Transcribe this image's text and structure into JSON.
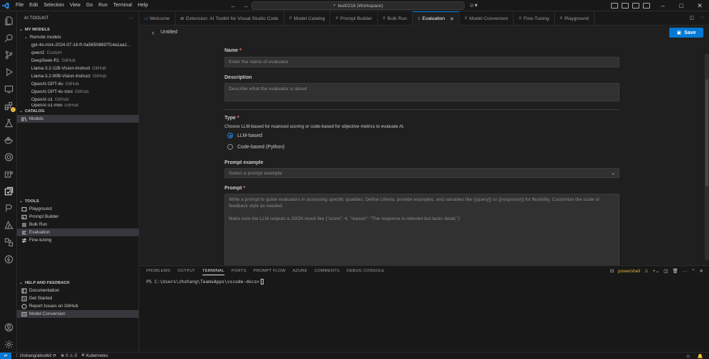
{
  "menu": [
    "File",
    "Edit",
    "Selection",
    "View",
    "Go",
    "Run",
    "Terminal",
    "Help"
  ],
  "command_center": {
    "label": "test0218 (Workspace)"
  },
  "colors": {
    "accent": "#0078d4",
    "required": "#f48771",
    "warning": "#e3b341"
  },
  "sidebar": {
    "title": "AI TOOLKIT",
    "my_models": {
      "title": "MY MODELS",
      "group": "Remote models",
      "items": [
        {
          "label": "gpt-4o-mini-2024-07-18-ft-0a56508897f14a1aa1...",
          "source": ""
        },
        {
          "label": "qwen2",
          "source": "Custom"
        },
        {
          "label": "DeepSeek-R1",
          "source": "GitHub"
        },
        {
          "label": "Llama-3.2-11B-Vision-Instruct",
          "source": "GitHub"
        },
        {
          "label": "Llama-3.2-90B-Vision-Instruct",
          "source": "GitHub"
        },
        {
          "label": "OpenAI GPT-4o",
          "source": "GitHub"
        },
        {
          "label": "OpenAI GPT-4o mini",
          "source": "GitHub"
        },
        {
          "label": "OpenAI o1",
          "source": "GitHub"
        },
        {
          "label": "OpenAI o1-mini",
          "source": "GitHub"
        }
      ]
    },
    "catalog": {
      "title": "CATALOG",
      "items": [
        {
          "label": "Models",
          "icon": "models-icon"
        }
      ]
    },
    "tools": {
      "title": "TOOLS",
      "items": [
        {
          "label": "Playground",
          "icon": "playground-icon"
        },
        {
          "label": "Prompt Builder",
          "icon": "prompt-builder-icon"
        },
        {
          "label": "Bulk Run",
          "icon": "bulk-run-icon"
        },
        {
          "label": "Evaluation",
          "icon": "evaluation-icon"
        },
        {
          "label": "Fine-tuning",
          "icon": "fine-tuning-icon"
        }
      ]
    },
    "help": {
      "title": "HELP AND FEEDBACK",
      "items": [
        {
          "label": "Documentation",
          "icon": "book-icon"
        },
        {
          "label": "Get Started",
          "icon": "rocket-icon"
        },
        {
          "label": "Report Issues on GitHub",
          "icon": "github-icon"
        },
        {
          "label": "Model Conversion",
          "icon": "conversion-icon"
        }
      ]
    }
  },
  "tabs": [
    {
      "label": "Welcome",
      "icon": "vscode-icon"
    },
    {
      "label": "Extension: AI Toolkit for Visual Studio Code",
      "icon": "extension-icon"
    },
    {
      "label": "Model Catalog",
      "icon": "aitk-icon"
    },
    {
      "label": "Prompt Builder",
      "icon": "aitk-icon"
    },
    {
      "label": "Bulk Run",
      "icon": "aitk-icon"
    },
    {
      "label": "Evaluation",
      "icon": "aitk-icon",
      "active": true
    },
    {
      "label": "Model Conversion",
      "icon": "aitk-icon"
    },
    {
      "label": "Fine-Tuning",
      "icon": "aitk-icon"
    },
    {
      "label": "Playground",
      "icon": "aitk-icon"
    }
  ],
  "editor": {
    "title": "Untitled",
    "save_label": "Save",
    "form": {
      "name_label": "Name",
      "name_placeholder": "Enter the name of evaluator",
      "description_label": "Description",
      "description_placeholder": "Describe what the evaluator is about",
      "type_label": "Type",
      "type_helper": "Choose LLM-based for nuanced scoring or code-based for objective metrics to evaluate AI.",
      "type_options": [
        {
          "label": "LLM-based",
          "selected": true
        },
        {
          "label": "Code-based (Python)",
          "selected": false
        }
      ],
      "prompt_example_label": "Prompt example",
      "prompt_example_value": "Select a prompt example",
      "prompt_label": "Prompt",
      "prompt_line1": "Write a prompt to guide evaluators in assessing specific qualities. Define criteria, provide examples, and variables like {{query}} or {{response}} for flexibility. Customize the scale or feedback style as needed.",
      "prompt_line2": "Make sure the LLM outputs a JSON result like {\"score\": 4, \"reason\": \"The response is relevant but lacks detail.\"}"
    }
  },
  "panel": {
    "tabs": [
      "PROBLEMS",
      "OUTPUT",
      "TERMINAL",
      "PORTS",
      "PROMPT FLOW",
      "AZURE",
      "COMMENTS",
      "DEBUG CONSOLE"
    ],
    "active_tab": "TERMINAL",
    "shell": "powershell",
    "terminal_line": "PS C:\\Users\\zhshang\\TeamsApps\\vscode-docs>"
  },
  "status": {
    "branch": "zhshang/aitoolkit",
    "errors": "0",
    "warnings": "0",
    "kubernetes": "Kubernetes"
  }
}
